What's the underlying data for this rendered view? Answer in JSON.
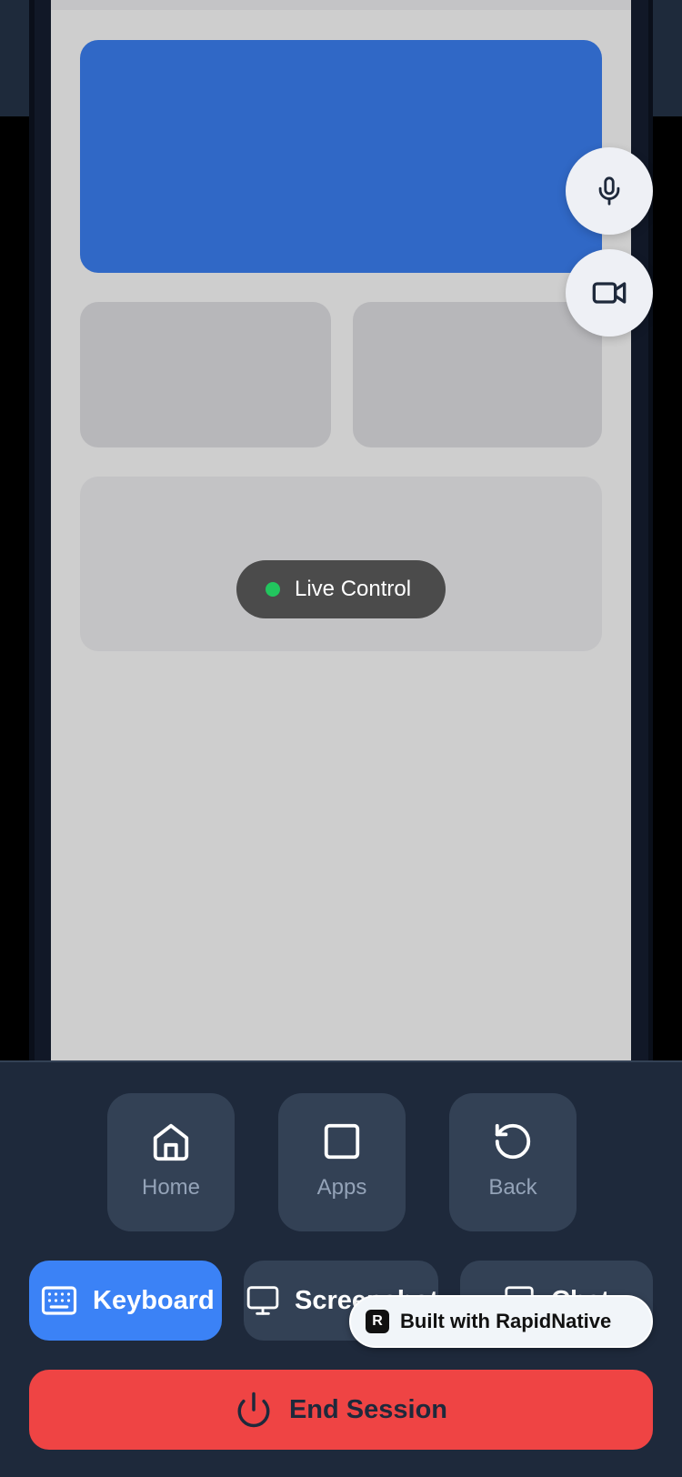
{
  "phone_screen": {
    "live_indicator": {
      "label": "Live Control",
      "dot_color": "#22c55e"
    },
    "floating_actions": [
      {
        "icon": "microphone-icon"
      },
      {
        "icon": "video-camera-icon"
      }
    ]
  },
  "nav": {
    "items": [
      {
        "label": "Home",
        "icon": "home-icon"
      },
      {
        "label": "Apps",
        "icon": "square-icon"
      },
      {
        "label": "Back",
        "icon": "rotate-ccw-icon"
      }
    ]
  },
  "actions": {
    "keyboard": {
      "label": "Keyboard",
      "icon": "keyboard-icon"
    },
    "screenshot": {
      "label": "Screenshot",
      "icon": "monitor-icon"
    },
    "chat": {
      "label": "Chat",
      "icon": "chat-icon"
    }
  },
  "end_session": {
    "label": "End Session",
    "icon": "power-icon"
  },
  "badge": {
    "logo": "R",
    "text": "Built with RapidNative"
  },
  "colors": {
    "accent_blue": "#3b82f6",
    "danger_red": "#ef4444",
    "panel_bg": "#1e293b",
    "tile_bg": "#334155",
    "hero_card": "#3068c6"
  }
}
